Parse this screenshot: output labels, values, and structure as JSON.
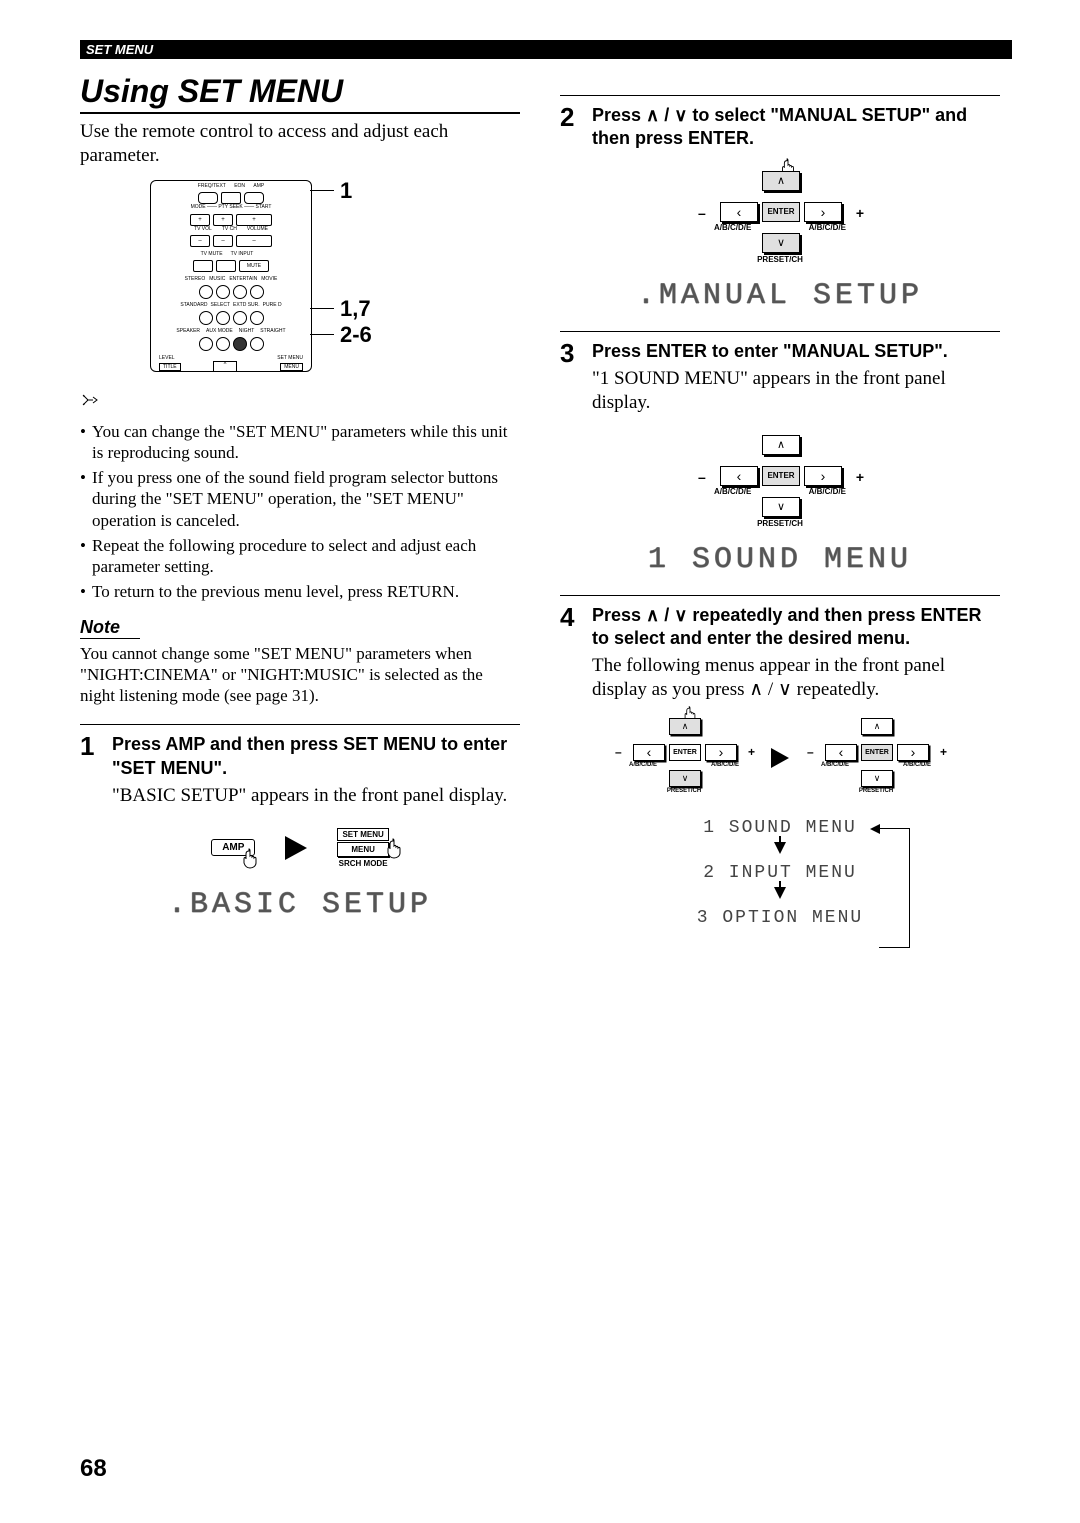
{
  "header": {
    "section": "SET MENU"
  },
  "title": "Using SET MENU",
  "intro": "Use the remote control to access and adjust each parameter.",
  "callouts": {
    "c1": "1",
    "c2": "1,7",
    "c3": "2-6"
  },
  "tips": [
    "You can change the \"SET MENU\" parameters while this unit is reproducing sound.",
    "If you press one of the sound field program selector buttons during the \"SET MENU\" operation, the \"SET MENU\" operation is canceled.",
    "Repeat the following procedure to select and adjust each parameter setting.",
    "To return to the previous menu level, press RETURN."
  ],
  "note_label": "Note",
  "note_body": "You cannot change some \"SET MENU\" parameters when \"NIGHT:CINEMA\" or \"NIGHT:MUSIC\" is selected as the night listening mode (see page 31).",
  "steps": {
    "s1": {
      "num": "1",
      "bold": "Press AMP and then press SET MENU to enter \"SET MENU\".",
      "text": "\"BASIC SETUP\" appears in the front panel display."
    },
    "s2": {
      "num": "2",
      "bold": "Press ∧ / ∨ to select \"MANUAL SETUP\" and then press ENTER."
    },
    "s3": {
      "num": "3",
      "bold": "Press ENTER to enter \"MANUAL SETUP\".",
      "text": "\"1 SOUND MENU\" appears in the front panel display."
    },
    "s4": {
      "num": "4",
      "bold": "Press ∧ / ∨ repeatedly and then press ENTER to select and enter the desired menu.",
      "text": "The following menus appear in the front panel display as you press ∧ / ∨ repeatedly."
    }
  },
  "lcd": {
    "basic": ".BASIC SETUP",
    "manual": ".MANUAL SETUP",
    "sound": "1 SOUND MENU"
  },
  "fig": {
    "amp": "AMP",
    "setmenu": "SET MENU",
    "menu": "MENU",
    "srch": "SRCH MODE",
    "enter": "ENTER",
    "abcde": "A/B/C/D/E",
    "preset": "PRESET/CH",
    "minus": "–",
    "plus": "+"
  },
  "flow": {
    "m1": "1 SOUND MENU",
    "m2": "2 INPUT MENU",
    "m3": "3 OPTION MENU"
  },
  "page_number": "68"
}
